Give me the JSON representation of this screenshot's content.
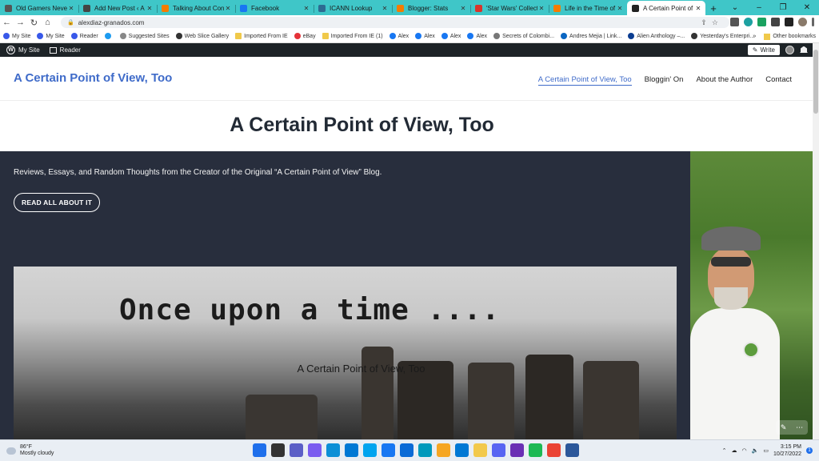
{
  "browser": {
    "tabs": [
      {
        "title": "Old Gamers Never Di...",
        "color": "#555555"
      },
      {
        "title": "Add New Post ‹ A Cer...",
        "color": "#444444"
      },
      {
        "title": "Talking About Conser...",
        "color": "#f57c00"
      },
      {
        "title": "Facebook",
        "color": "#1877f2"
      },
      {
        "title": "ICANN Lookup",
        "color": "#2d6b91"
      },
      {
        "title": "Blogger: Stats",
        "color": "#f57c00"
      },
      {
        "title": "'Star Wars' Collectible...",
        "color": "#d9342b"
      },
      {
        "title": "Life in the Time of Co...",
        "color": "#f57c00"
      },
      {
        "title": "A Certain Point of Vie...",
        "color": "#222222"
      }
    ],
    "new_tab": "+",
    "url": "alexdiaz-granados.com",
    "bookmarks": [
      {
        "label": "My Site",
        "color": "#3858e9"
      },
      {
        "label": "My Site",
        "color": "#3858e9"
      },
      {
        "label": "Reader",
        "color": "#3858e9"
      },
      {
        "label": "",
        "color": "#1d9bf0"
      },
      {
        "label": "Suggested Sites",
        "color": "#888888"
      },
      {
        "label": "Web Slice Gallery",
        "color": "#333333"
      },
      {
        "label": "Imported From IE",
        "color": "folder"
      },
      {
        "label": "eBay",
        "color": "#e53238"
      },
      {
        "label": "Imported From IE (1)",
        "color": "folder"
      },
      {
        "label": "Alex",
        "color": "#1877f2"
      },
      {
        "label": "Alex",
        "color": "#1877f2"
      },
      {
        "label": "Alex",
        "color": "#1877f2"
      },
      {
        "label": "Alex",
        "color": "#1877f2"
      },
      {
        "label": "Secrets of Colombi...",
        "color": "#777777"
      },
      {
        "label": "Andres Mejia | Link...",
        "color": "#0a66c2"
      },
      {
        "label": "Alien Anthology –...",
        "color": "#0a3d91"
      },
      {
        "label": "Yesterday's Enterpri...",
        "color": "#333333"
      }
    ],
    "bookmarks_overflow": "»",
    "other_bookmarks": "Other bookmarks"
  },
  "wp_bar": {
    "my_site": "My Site",
    "reader": "Reader",
    "write": "Write"
  },
  "site": {
    "title": "A Certain Point of View, Too",
    "nav": [
      {
        "label": "A Certain Point of View, Too",
        "current": true
      },
      {
        "label": "Bloggin' On",
        "current": false
      },
      {
        "label": "About the Author",
        "current": false
      },
      {
        "label": "Contact",
        "current": false
      }
    ],
    "page_heading": "A Certain Point of View, Too",
    "tagline": "Reviews, Essays, and Random Thoughts from the Creator of the Original “A Certain Point of View” Blog.",
    "cta": "READ ALL ABOUT IT",
    "hero_image_text": "Once upon a time ....",
    "hero_caption": "A Certain Point of View, Too"
  },
  "taskbar": {
    "temp": "86°F",
    "condition": "Mostly cloudy",
    "time": "3:15 PM",
    "date": "10/27/2022",
    "notification_count": "1",
    "app_colors": [
      "#1f6feb",
      "#333333",
      "#5b5fc7",
      "#7a5cf0",
      "#0c8fd6",
      "#0078d4",
      "#00a4ef",
      "#1877f2",
      "#0a6ad6",
      "#0099bc",
      "#f6a623",
      "#0078d4",
      "#f2c94c",
      "#5865f2",
      "#6a2fb4",
      "#1db954",
      "#ea4335",
      "#2b579a"
    ]
  }
}
